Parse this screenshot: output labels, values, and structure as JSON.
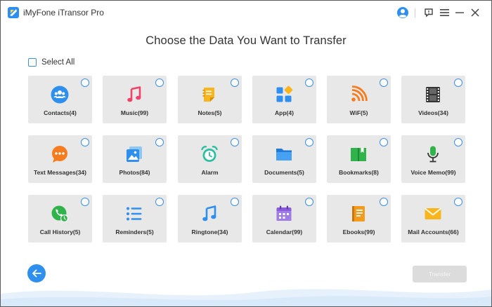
{
  "window": {
    "title": "iMyFone iTransor Pro"
  },
  "heading": "Choose the Data You Want to Transfer",
  "select_all": {
    "label": "Select All",
    "checked": false
  },
  "tiles": [
    {
      "label": "Contacts(4)",
      "icon": "contacts-icon"
    },
    {
      "label": "Music(99)",
      "icon": "music-icon"
    },
    {
      "label": "Notes(5)",
      "icon": "notes-icon"
    },
    {
      "label": "App(4)",
      "icon": "app-icon"
    },
    {
      "label": "WiF(5)",
      "icon": "wifi-icon"
    },
    {
      "label": "Videos(34)",
      "icon": "videos-icon"
    },
    {
      "label": "Text Messages(34)",
      "icon": "text-messages-icon"
    },
    {
      "label": "Photos(84)",
      "icon": "photos-icon"
    },
    {
      "label": "Alarm",
      "icon": "alarm-icon"
    },
    {
      "label": "Documents(5)",
      "icon": "documents-icon"
    },
    {
      "label": "Bookmarks(8)",
      "icon": "bookmarks-icon"
    },
    {
      "label": "Voice Memo(99)",
      "icon": "voice-memo-icon"
    },
    {
      "label": "Call History(5)",
      "icon": "call-history-icon"
    },
    {
      "label": "Reminders(5)",
      "icon": "reminders-icon"
    },
    {
      "label": "Ringtone(34)",
      "icon": "ringtone-icon"
    },
    {
      "label": "Calendar(99)",
      "icon": "calendar-icon"
    },
    {
      "label": "Ebooks(99)",
      "icon": "ebooks-icon"
    },
    {
      "label": "Mail Accounts(66)",
      "icon": "mail-accounts-icon"
    }
  ],
  "footer": {
    "transfer_label": "Transfer",
    "transfer_enabled": false
  },
  "colors": {
    "accent": "#2f8fee",
    "tile_bg": "#e8e8e8",
    "disabled_button": "#dcdcdc"
  }
}
